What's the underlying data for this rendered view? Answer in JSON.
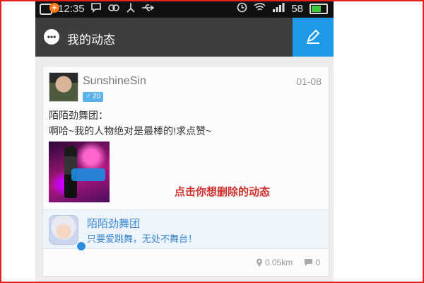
{
  "status_bar": {
    "time": "12:35",
    "battery": "58",
    "battery_level": 0.58,
    "icons": [
      "app-plus-icon",
      "chat-icon",
      "link-icon",
      "share-icon",
      "usb-icon",
      "clock-icon",
      "wifi-icon",
      "signal-icon",
      "battery-icon"
    ]
  },
  "header": {
    "title": "我的动态",
    "icon": "chat-bubble-icon",
    "compose_icon": "pencil-icon"
  },
  "post": {
    "username": "SunshineSin",
    "gender_age": "♂ 20",
    "date": "01-08",
    "line1": "陌陌劲舞团：",
    "line2": "啊哈~我的人物绝对是最棒的!求点赞~"
  },
  "annotation": "点击你想删除的动态",
  "share": {
    "app_name": "陌陌劲舞团",
    "slogan": "只要爱跳舞，无处不舞台！"
  },
  "footer": {
    "distance": "0.05km",
    "comments": "0"
  },
  "colors": {
    "header_bg": "#3d3d3d",
    "compose_bg": "#1e9be8",
    "annotation": "#d0312d",
    "link_blue": "#3a86cf",
    "frame": "#e52020"
  }
}
